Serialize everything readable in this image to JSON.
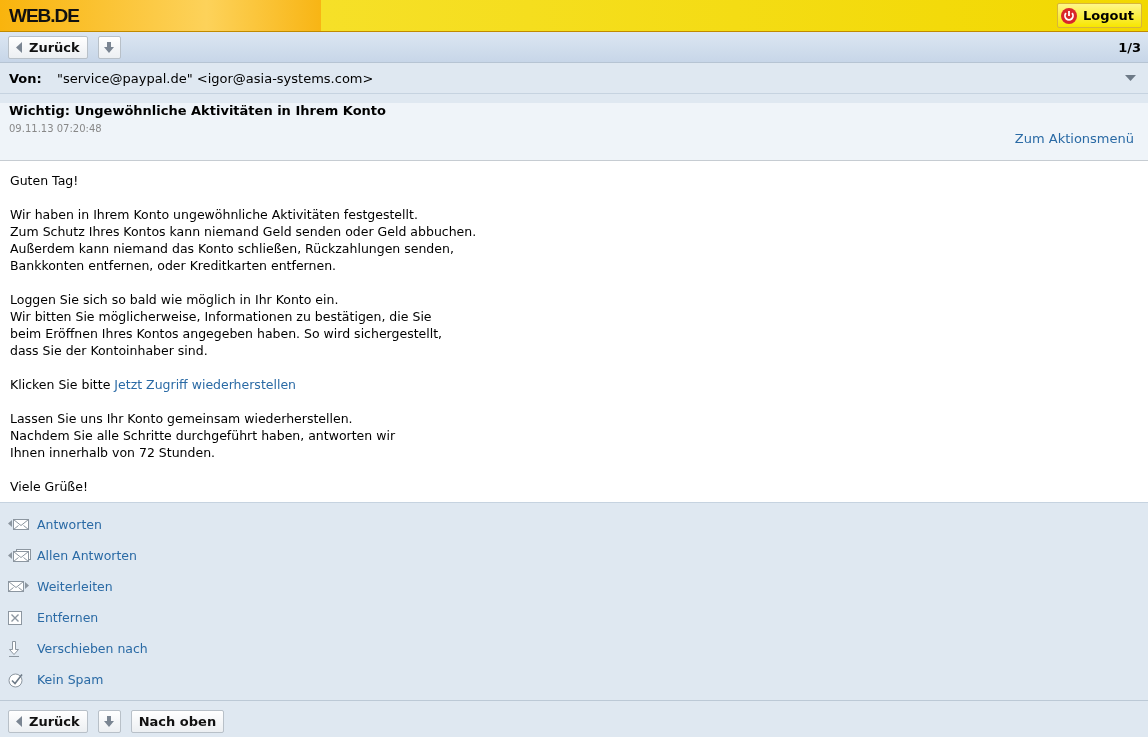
{
  "header": {
    "logo": "WEB.DE",
    "logout": "Logout"
  },
  "toolbar": {
    "back": "Zurück",
    "counter": "1/3"
  },
  "from": {
    "label": "Von:",
    "value": "\"service@paypal.de\" <igor@asia-systems.com>"
  },
  "subject": {
    "title": "Wichtig: Ungewöhnliche Aktivitäten in Ihrem Konto",
    "date": "09.11.13 07:20:48",
    "menu_link": "Zum Aktionsmenü"
  },
  "body": [
    {
      "lines": [
        "Guten Tag!"
      ]
    },
    {
      "lines": [
        "Wir haben in Ihrem Konto ungewöhnliche Aktivitäten festgestellt.",
        "Zum Schutz Ihres Kontos kann niemand Geld senden oder Geld abbuchen.",
        "Außerdem kann niemand das Konto schließen, Rückzahlungen senden,",
        "Bankkonten entfernen, oder Kreditkarten entfernen."
      ]
    },
    {
      "lines": [
        "Loggen Sie sich so bald wie möglich in Ihr Konto ein.",
        "Wir bitten Sie möglicherweise, Informationen zu bestätigen, die Sie",
        "beim Eröffnen Ihres Kontos angegeben haben. So wird sichergestellt,",
        "dass Sie der Kontoinhaber sind."
      ]
    },
    {
      "lines": [
        "Klicken Sie bitte"
      ],
      "link": "Jetzt Zugriff wiederherstellen"
    },
    {
      "lines": [
        "Lassen Sie uns Ihr Konto gemeinsam wiederherstellen.",
        "Nachdem Sie alle Schritte durchgeführt haben, antworten wir",
        "Ihnen innerhalb von 72 Stunden."
      ]
    },
    {
      "lines": [
        "Viele Grüße!"
      ]
    }
  ],
  "actions": [
    {
      "kind": "reply",
      "label": "Antworten"
    },
    {
      "kind": "reply_all",
      "label": "Allen Antworten"
    },
    {
      "kind": "forward",
      "label": "Weiterleiten"
    },
    {
      "kind": "delete",
      "label": "Entfernen"
    },
    {
      "kind": "move",
      "label": "Verschieben nach"
    },
    {
      "kind": "not_spam",
      "label": "Kein Spam"
    }
  ],
  "bottom_bar": {
    "back": "Zurück",
    "top": "Nach oben"
  }
}
